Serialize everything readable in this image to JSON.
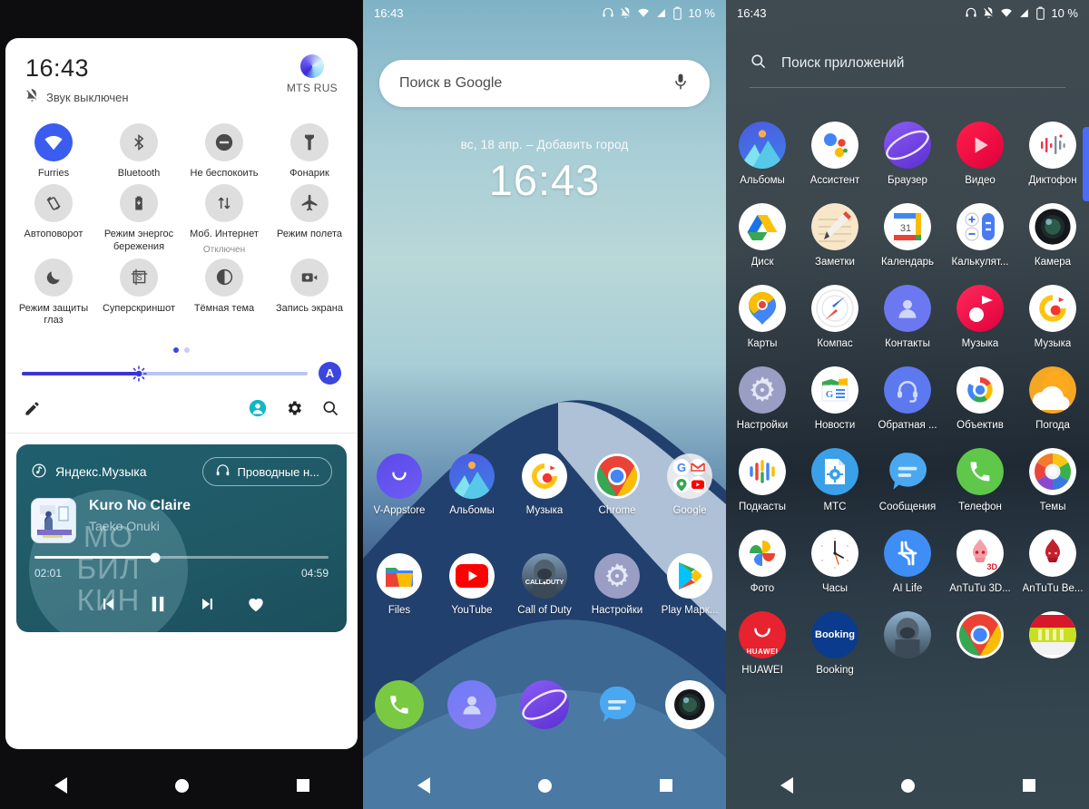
{
  "statusbar": {
    "time": "16:43",
    "battery": "10 %",
    "icons": [
      "headphones-icon",
      "bell-off-icon",
      "wifi-icon",
      "signal-icon",
      "battery-icon"
    ]
  },
  "quick_settings": {
    "time": "16:43",
    "mute_label": "Звук выключен",
    "carrier": "MTS RUS",
    "tiles": [
      {
        "label": "Furries",
        "icon": "wifi-icon",
        "state": "on",
        "sub": ""
      },
      {
        "label": "Bluetooth",
        "icon": "bluetooth-icon",
        "state": "off",
        "sub": ""
      },
      {
        "label": "Не беспокоить",
        "icon": "do-not-disturb-icon",
        "state": "off",
        "sub": ""
      },
      {
        "label": "Фонарик",
        "icon": "flashlight-icon",
        "state": "off",
        "sub": ""
      },
      {
        "label": "Автоповорот",
        "icon": "auto-rotate-icon",
        "state": "off",
        "sub": ""
      },
      {
        "label": "Режим энергос бережения",
        "icon": "battery-saver-icon",
        "state": "off",
        "sub": ""
      },
      {
        "label": "Моб. Интернет",
        "icon": "mobile-data-icon",
        "state": "off",
        "sub": "Отключен"
      },
      {
        "label": "Режим полета",
        "icon": "airplane-icon",
        "state": "off",
        "sub": ""
      },
      {
        "label": "Режим защиты глаз",
        "icon": "moon-icon",
        "state": "off",
        "sub": ""
      },
      {
        "label": "Суперскриншот",
        "icon": "screenshot-icon",
        "state": "off",
        "sub": ""
      },
      {
        "label": "Тёмная тема",
        "icon": "contrast-icon",
        "state": "off",
        "sub": ""
      },
      {
        "label": "Запись экрана",
        "icon": "screen-record-icon",
        "state": "off",
        "sub": ""
      }
    ],
    "page_dots": 2,
    "active_dot": 0,
    "brightness_percent": 41,
    "auto_brightness_label": "A",
    "footer_icons": [
      "edit-icon",
      "user-icon",
      "gear-icon",
      "search-icon"
    ],
    "accent_color": "#3b45e0"
  },
  "media_player": {
    "app_name": "Яндекс.Музыка",
    "output_label": "Проводные н...",
    "title": "Kuro No Claire",
    "artist": "Taeko Onuki",
    "elapsed": "02:01",
    "duration": "04:59",
    "progress_percent": 41,
    "controls": [
      "prev-icon",
      "pause-icon",
      "next-icon",
      "heart-icon"
    ],
    "watermark": [
      "МО",
      "БИЛ",
      "КИН"
    ]
  },
  "home": {
    "search_placeholder": "Поиск в Google",
    "search_mic_icon": "microphone-icon",
    "date_text": "вс, 18 апр.   – Добавить город",
    "clock": "16:43",
    "row1": [
      {
        "label": "V-Appstore",
        "icon": "v-appstore-icon"
      },
      {
        "label": "Альбомы",
        "icon": "albums-icon"
      },
      {
        "label": "Музыка",
        "icon": "music-yellow-icon"
      },
      {
        "label": "Chrome",
        "icon": "chrome-icon"
      },
      {
        "label": "Google",
        "icon": "google-folder-icon"
      }
    ],
    "row2": [
      {
        "label": "Files",
        "icon": "files-icon"
      },
      {
        "label": "YouTube",
        "icon": "youtube-icon"
      },
      {
        "label": "Call of Duty",
        "icon": "call-of-duty-icon"
      },
      {
        "label": "Настройки",
        "icon": "settings-icon"
      },
      {
        "label": "Play Марк...",
        "icon": "play-store-icon"
      }
    ],
    "dock": [
      {
        "label": "",
        "icon": "phone-icon"
      },
      {
        "label": "",
        "icon": "contacts-icon"
      },
      {
        "label": "",
        "icon": "browser-icon"
      },
      {
        "label": "",
        "icon": "messages-icon"
      },
      {
        "label": "",
        "icon": "camera-icon"
      }
    ]
  },
  "drawer": {
    "search_placeholder": "Поиск приложений",
    "search_icon": "search-icon",
    "scrollbar_color": "#4a6cf7",
    "apps": [
      {
        "label": "Альбомы",
        "icon": "albums-icon"
      },
      {
        "label": "Ассистент",
        "icon": "assistant-icon"
      },
      {
        "label": "Браузер",
        "icon": "browser-icon"
      },
      {
        "label": "Видео",
        "icon": "video-icon"
      },
      {
        "label": "Диктофон",
        "icon": "recorder-icon"
      },
      {
        "label": "Диск",
        "icon": "drive-icon"
      },
      {
        "label": "Заметки",
        "icon": "notes-icon"
      },
      {
        "label": "Календарь",
        "icon": "calendar-icon"
      },
      {
        "label": "Калькулят...",
        "icon": "calculator-icon"
      },
      {
        "label": "Камера",
        "icon": "camera-icon"
      },
      {
        "label": "Карты",
        "icon": "maps-icon"
      },
      {
        "label": "Компас",
        "icon": "compass-icon"
      },
      {
        "label": "Контакты",
        "icon": "contacts-icon"
      },
      {
        "label": "Музыка",
        "icon": "music-red-icon"
      },
      {
        "label": "Музыка",
        "icon": "music-yellow-icon"
      },
      {
        "label": "Настройки",
        "icon": "settings-icon"
      },
      {
        "label": "Новости",
        "icon": "news-icon"
      },
      {
        "label": "Обратная ...",
        "icon": "feedback-icon"
      },
      {
        "label": "Объектив",
        "icon": "lens-icon"
      },
      {
        "label": "Погода",
        "icon": "weather-icon"
      },
      {
        "label": "Подкасты",
        "icon": "podcasts-icon"
      },
      {
        "label": "МТС",
        "icon": "mts-icon"
      },
      {
        "label": "Сообщения",
        "icon": "messages-icon"
      },
      {
        "label": "Телефон",
        "icon": "phone-icon"
      },
      {
        "label": "Темы",
        "icon": "themes-icon"
      },
      {
        "label": "Фото",
        "icon": "photos-icon"
      },
      {
        "label": "Часы",
        "icon": "clock-icon"
      },
      {
        "label": "AI Life",
        "icon": "ai-life-icon"
      },
      {
        "label": "AnTuTu 3D...",
        "icon": "antutu-3d-icon"
      },
      {
        "label": "AnTuTu Be...",
        "icon": "antutu-bench-icon"
      }
    ],
    "partial_row": [
      {
        "label": "HUAWEI",
        "icon": "huawei-appgallery-icon"
      },
      {
        "label": "Booking",
        "icon": "booking-icon"
      },
      {
        "label": "",
        "icon": "call-of-duty-icon"
      },
      {
        "label": "",
        "icon": "chrome-icon"
      },
      {
        "label": "",
        "icon": "misc-app-icon"
      }
    ]
  },
  "navbar": {
    "back": "back-icon",
    "home": "home-icon",
    "recents": "recents-icon"
  }
}
